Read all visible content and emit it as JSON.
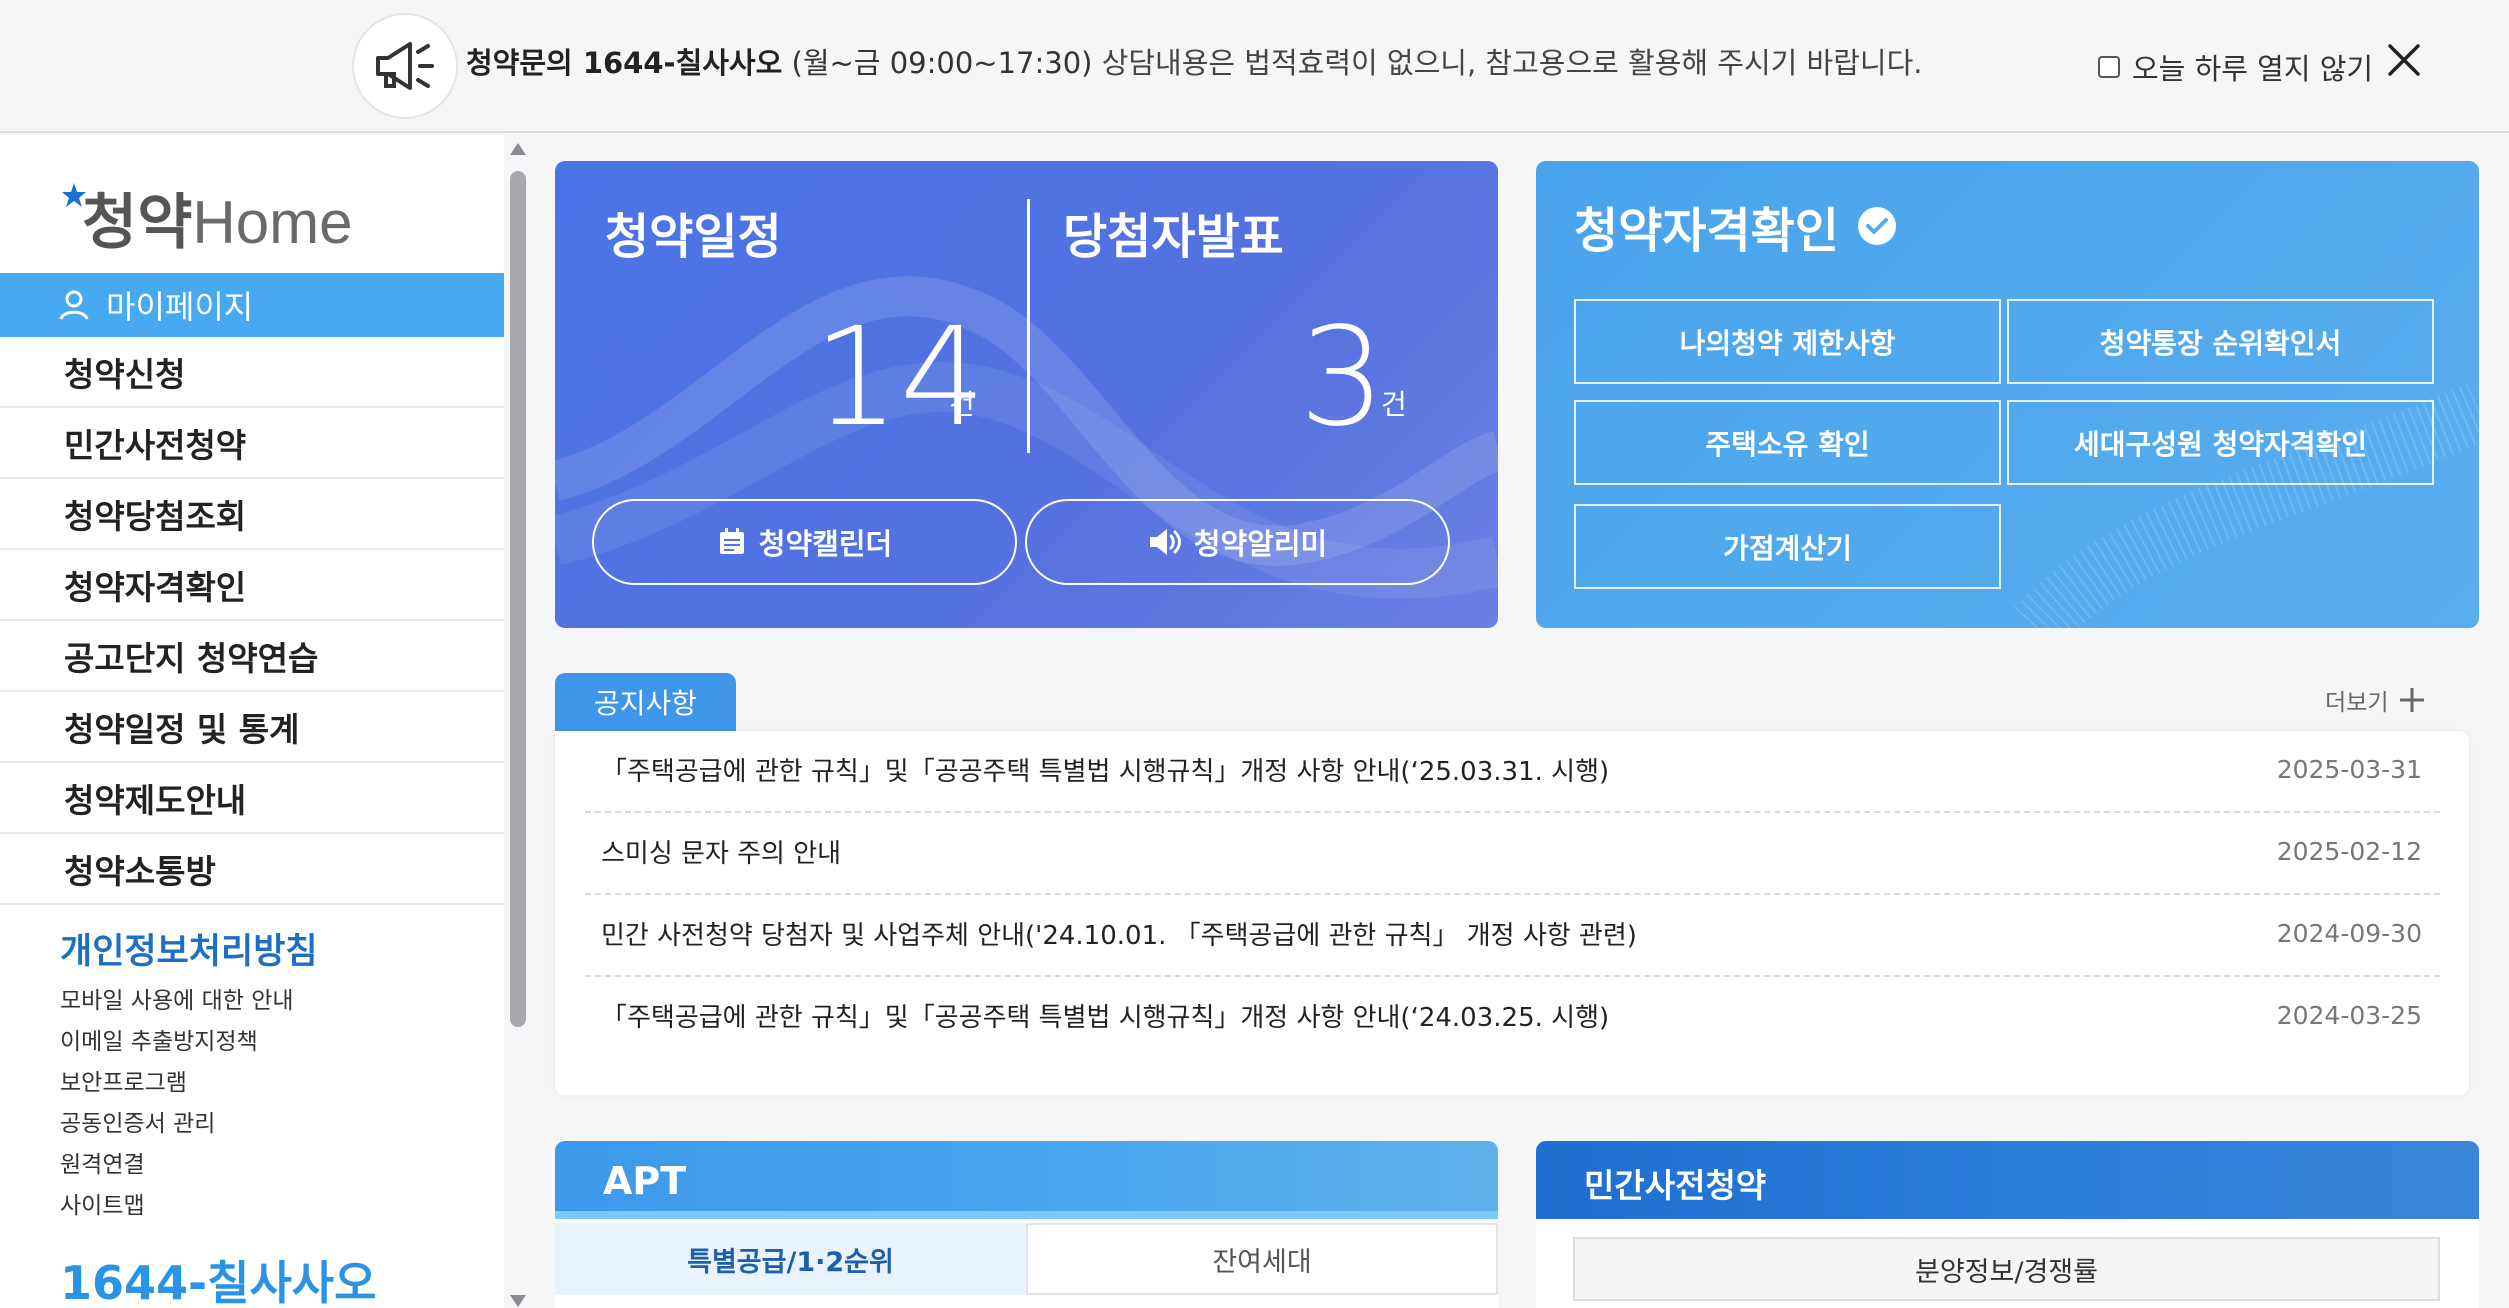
{
  "banner": {
    "bold": "청약문의 1644-칠사사오",
    "hours": "(월~금 09:00~17:30)",
    "rest": "상담내용은 법적효력이 없으니, 참고용으로 활용해 주시기 바랍니다.",
    "dismiss_label": "오늘 하루 열지 않기"
  },
  "sidebar": {
    "logo_text": "청약Home",
    "active_item": "마이페이지",
    "items": [
      "청약신청",
      "민간사전청약",
      "청약당첨조회",
      "청약자격확인",
      "공고단지 청약연습",
      "청약일정 및 통계",
      "청약제도안내",
      "청약소통방"
    ],
    "privacy_title": "개인정보처리방침",
    "sub_links": [
      "모바일 사용에 대한 안내",
      "이메일 추출방지정책",
      "보안프로그램",
      "공동인증서 관리",
      "원격연결",
      "사이트맵"
    ],
    "phone": "1644-칠사사오"
  },
  "schedule_card": {
    "left_title": "청약일정",
    "left_count": "14",
    "right_title": "당첨자발표",
    "right_count": "3",
    "unit": "건",
    "calendar_label": "청약캘린더",
    "alarm_label": "청약알리미"
  },
  "qualification_card": {
    "title": "청약자격확인",
    "buttons": [
      "나의청약 제한사항",
      "청약통장 순위확인서",
      "주택소유 확인",
      "세대구성원 청약자격확인",
      "가점계산기"
    ]
  },
  "notices": {
    "tab_label": "공지사항",
    "more_label": "더보기",
    "rows": [
      {
        "title": "「주택공급에 관한 규칙」및「공공주택 특별법 시행규칙」개정 사항 안내(‘25.03.31. 시행)",
        "date": "2025-03-31"
      },
      {
        "title": "스미싱 문자 주의 안내",
        "date": "2025-02-12"
      },
      {
        "title": "민간 사전청약 당첨자 및 사업주체 안내('24.10.01. 「주택공급에 관한 규칙」 개정 사항 관련)",
        "date": "2024-09-30"
      },
      {
        "title": "「주택공급에 관한 규칙」및「공공주택 특별법 시행규칙」개정 사항 안내(‘24.03.25. 시행)",
        "date": "2024-03-25"
      }
    ]
  },
  "apt": {
    "title": "APT",
    "tab_active": "특별공급/1·2순위",
    "tab_inactive": "잔여세대"
  },
  "pre_sale": {
    "title": "민간사전청약",
    "button": "분양정보/경쟁률"
  },
  "colors": {
    "schedule_card": "#4f73e3",
    "qualification_card": "#52a9ee",
    "active_nav": "#47a9ef",
    "link_blue": "#1e6fc4"
  }
}
